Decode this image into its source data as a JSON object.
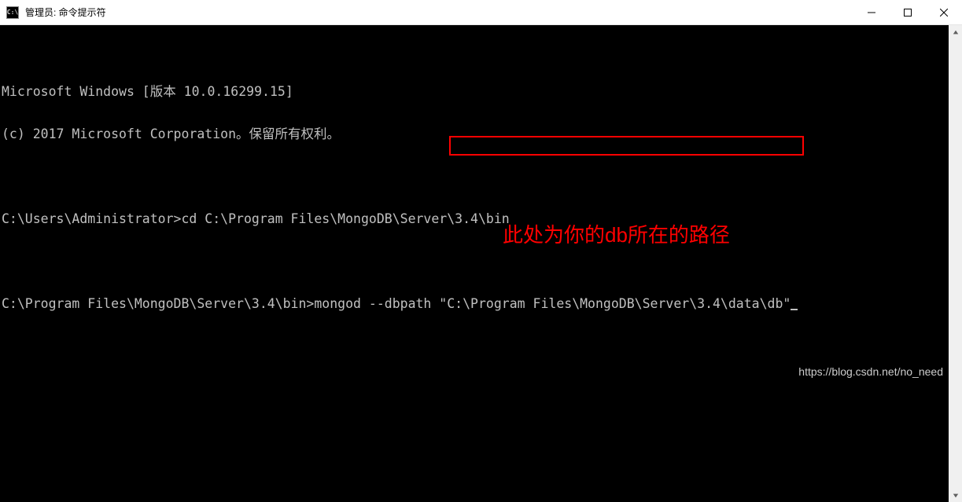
{
  "window": {
    "title": "管理员: 命令提示符"
  },
  "terminal": {
    "lines": {
      "l1": "Microsoft Windows [版本 10.0.16299.15]",
      "l2": "(c) 2017 Microsoft Corporation。保留所有权利。",
      "l3": "",
      "l4_prompt": "C:\\Users\\Administrator>",
      "l4_cmd": "cd C:\\Program Files\\MongoDB\\Server\\3.4\\bin",
      "l5": "",
      "l6_prompt": "C:\\Program Files\\MongoDB\\Server\\3.4\\bin>",
      "l6_cmd_part1": "mongod --dbpath \"",
      "l6_cmd_path": "C:\\Program Files\\MongoDB\\Server\\3.4\\data\\db",
      "l6_cmd_part2": "\""
    }
  },
  "annotation": {
    "text": "此处为你的db所在的路径"
  },
  "watermark": {
    "text": "https://blog.csdn.net/no_need"
  }
}
